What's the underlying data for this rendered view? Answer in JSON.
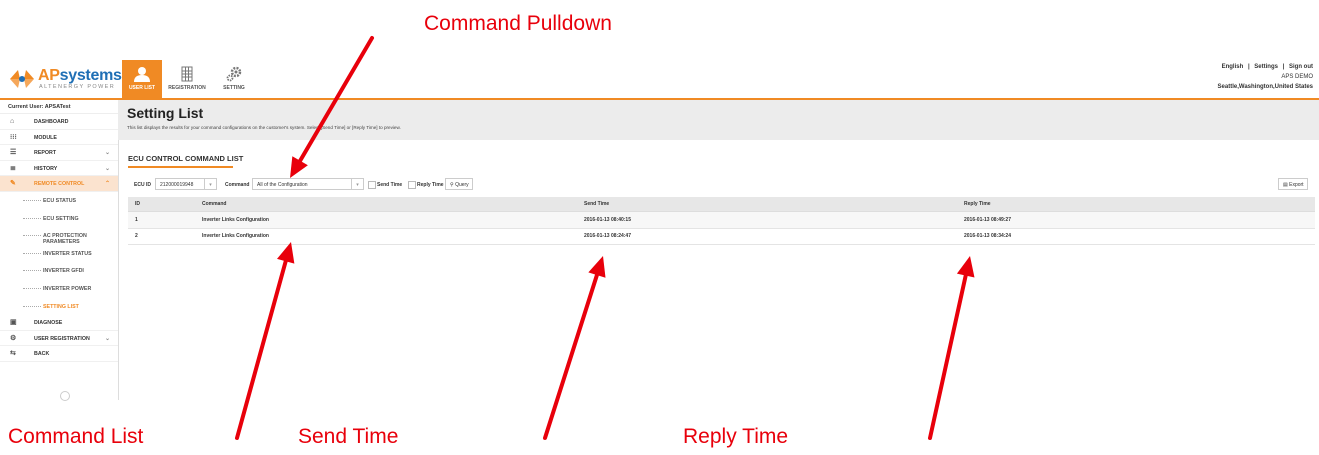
{
  "annotations": {
    "command_pulldown": "Command Pulldown",
    "command_list": "Command List",
    "send_time": "Send Time",
    "reply_time": "Reply Time",
    "arrow_color": "#e8000b"
  },
  "header": {
    "logo_ap": "AP",
    "logo_systems": "systems",
    "logo_tagline": "ALTENERGY POWER",
    "nav_tabs": [
      {
        "label": "USER LIST",
        "icon": "user-icon",
        "active": true
      },
      {
        "label": "REGISTRATION",
        "icon": "grid-icon",
        "active": false
      },
      {
        "label": "SETTING",
        "icon": "gear-icon",
        "active": false
      }
    ],
    "links": [
      "English",
      "|",
      "Settings",
      "|",
      "Sign out"
    ],
    "account": "APS DEMO",
    "location": "Seattle,Washington,United States",
    "accent_color": "#f08a24"
  },
  "sidebar": {
    "current_user": "Current User: APSATest",
    "items": [
      {
        "label": "DASHBOARD",
        "icon": "home-icon"
      },
      {
        "label": "MODULE",
        "icon": "module-grid-icon"
      },
      {
        "label": "REPORT",
        "icon": "list-icon",
        "chevron": "⌄"
      },
      {
        "label": "HISTORY",
        "icon": "database-icon",
        "chevron": "⌄"
      },
      {
        "label": "REMOTE CONTROL",
        "icon": "wrench-icon",
        "chevron": "⌃"
      }
    ],
    "sub_items": [
      "ECU STATUS",
      "ECU SETTING",
      "AC PROTECTION PARAMETERS",
      "INVERTER STATUS",
      "INVERTER GFDI",
      "INVERTER POWER",
      "SETTING LIST"
    ],
    "items_after": [
      {
        "label": "DIAGNOSE",
        "icon": "diagnose-icon"
      },
      {
        "label": "USER REGISTRATION",
        "icon": "gears-icon",
        "chevron": "⌄"
      },
      {
        "label": "BACK",
        "icon": "back-icon"
      }
    ]
  },
  "main": {
    "title": "Setting List",
    "description": "This list displays the results for your command configurations on the customer's system. Select [Send Time] or [Reply Time] to preview.",
    "section_title": "ECU CONTROL COMMAND LIST",
    "filters": {
      "ecu_label": "ECU ID",
      "ecu_value": "212000019948",
      "command_label": "Command",
      "command_value": "All of the Configuration",
      "send_time_label": "Send Time",
      "reply_time_label": "Reply Time",
      "query_label": "Query",
      "export_label": "Export"
    },
    "table": {
      "headers": [
        "ID",
        "Command",
        "Send Time",
        "Reply Time"
      ],
      "rows": [
        [
          "1",
          "Inverter Links Configuration",
          "2016-01-13 08:40:15",
          "2016-01-13 08:49:27"
        ],
        [
          "2",
          "Inverter Links Configuration",
          "2016-01-13 08:24:47",
          "2016-01-13 08:34:24"
        ]
      ]
    }
  }
}
